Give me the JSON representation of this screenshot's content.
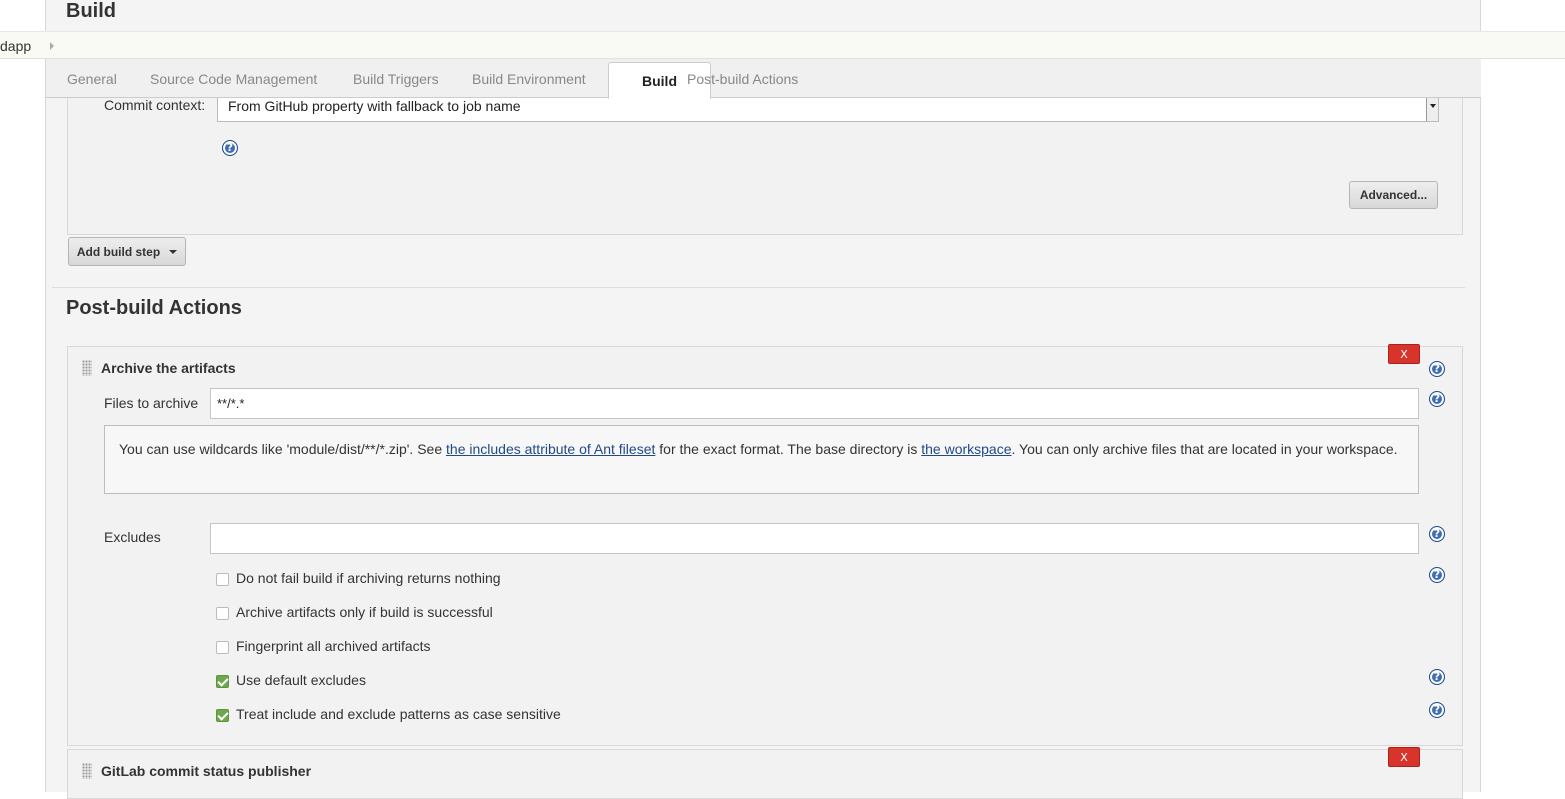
{
  "sections": {
    "build_title": "Build",
    "post_build_title": "Post-build Actions"
  },
  "breadcrumb": {
    "item": "dapp"
  },
  "tabs": [
    {
      "label": "General",
      "active": false
    },
    {
      "label": "Source Code Management",
      "active": false
    },
    {
      "label": "Build Triggers",
      "active": false
    },
    {
      "label": "Build Environment",
      "active": false
    },
    {
      "label": "Build",
      "active": true
    },
    {
      "label": "Post-build Actions",
      "active": false
    }
  ],
  "build_step": {
    "commit_context_label": "Commit context:",
    "commit_context_value": "From GitHub property with fallback to job name",
    "advanced_label": "Advanced...",
    "add_build_step_label": "Add build step"
  },
  "archive": {
    "title": "Archive the artifacts",
    "delete_label": "X",
    "files_label": "Files to archive",
    "files_value": "**/*.*",
    "help_text_1": "You can use wildcards like 'module/dist/**/*.zip'. See ",
    "help_link_1": "the includes attribute of Ant fileset",
    "help_text_2": " for the exact format. The base directory is ",
    "help_link_2": "the workspace",
    "help_text_3": ". You can only archive files that are located in your workspace.",
    "excludes_label": "Excludes",
    "excludes_value": "",
    "options": [
      {
        "label": "Do not fail build if archiving returns nothing",
        "checked": false
      },
      {
        "label": "Archive artifacts only if build is successful",
        "checked": false
      },
      {
        "label": "Fingerprint all archived artifacts",
        "checked": false
      },
      {
        "label": "Use default excludes",
        "checked": true
      },
      {
        "label": "Treat include and exclude patterns as case sensitive",
        "checked": true
      }
    ]
  },
  "gitlab": {
    "title": "GitLab commit status publisher",
    "delete_label": "X"
  },
  "help_icon_glyph": "?",
  "colors": {
    "delete_red": "#d9342c",
    "check_green": "#6fa84c",
    "help_blue": "#3d6db5",
    "link_blue": "#204a87"
  }
}
